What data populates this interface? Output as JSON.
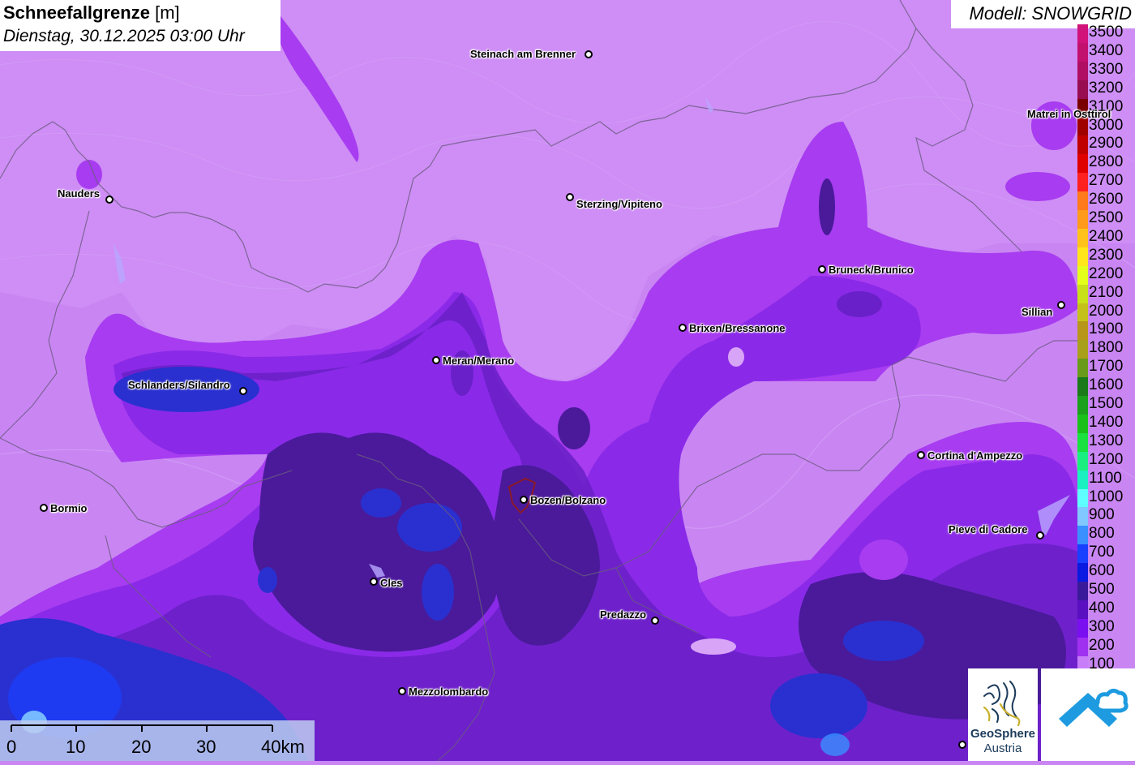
{
  "title": {
    "variable": "Schneefallgrenze",
    "unit": "[m]",
    "datetime": "Dienstag, 30.12.2025 03:00 Uhr"
  },
  "model": "Modell: SNOWGRID",
  "legend": {
    "items": [
      {
        "value": "3500",
        "color": "#d0127a"
      },
      {
        "value": "3400",
        "color": "#c2106f"
      },
      {
        "value": "3300",
        "color": "#b00e62"
      },
      {
        "value": "3200",
        "color": "#980c52"
      },
      {
        "value": "3100",
        "color": "#7a0000"
      },
      {
        "value": "3000",
        "color": "#a00000"
      },
      {
        "value": "2900",
        "color": "#c00000"
      },
      {
        "value": "2800",
        "color": "#e00000"
      },
      {
        "value": "2700",
        "color": "#ff2020"
      },
      {
        "value": "2600",
        "color": "#ff7a1a"
      },
      {
        "value": "2500",
        "color": "#ff9a1a"
      },
      {
        "value": "2400",
        "color": "#ffc21a"
      },
      {
        "value": "2300",
        "color": "#ffe61a"
      },
      {
        "value": "2200",
        "color": "#e4ff1a"
      },
      {
        "value": "2100",
        "color": "#c8e01a"
      },
      {
        "value": "2000",
        "color": "#c4c21a"
      },
      {
        "value": "1900",
        "color": "#b8961a"
      },
      {
        "value": "1800",
        "color": "#a8a01a"
      },
      {
        "value": "1700",
        "color": "#6a9a1a"
      },
      {
        "value": "1600",
        "color": "#1a7a1a"
      },
      {
        "value": "1500",
        "color": "#1aa01a"
      },
      {
        "value": "1400",
        "color": "#1ac01a"
      },
      {
        "value": "1300",
        "color": "#1ae040"
      },
      {
        "value": "1200",
        "color": "#1aee80"
      },
      {
        "value": "1100",
        "color": "#1af0c0"
      },
      {
        "value": "1000",
        "color": "#60ffff"
      },
      {
        "value": "900",
        "color": "#80c8ff"
      },
      {
        "value": "800",
        "color": "#3a90ff"
      },
      {
        "value": "700",
        "color": "#1a40ff"
      },
      {
        "value": "600",
        "color": "#0a1ae0"
      },
      {
        "value": "500",
        "color": "#3a1a9a"
      },
      {
        "value": "400",
        "color": "#5a10c0"
      },
      {
        "value": "300",
        "color": "#7a10f0"
      },
      {
        "value": "200",
        "color": "#a030f0"
      },
      {
        "value": "100",
        "color": "#c87ef8"
      }
    ]
  },
  "cities": [
    {
      "name": "Steinach am Brenner"
    },
    {
      "name": "Nauders"
    },
    {
      "name": "Sterzing/Vipiteno"
    },
    {
      "name": "Matrei in Osttirol"
    },
    {
      "name": "Bruneck/Brunico"
    },
    {
      "name": "Sillian"
    },
    {
      "name": "Brixen/Bressanone"
    },
    {
      "name": "Meran/Merano"
    },
    {
      "name": "Schlanders/Silandro"
    },
    {
      "name": "Cortina d'Ampezzo"
    },
    {
      "name": "Bormio"
    },
    {
      "name": "Bozen/Bolzano"
    },
    {
      "name": "Pieve di Cadore"
    },
    {
      "name": "Cles"
    },
    {
      "name": "Predazzo"
    },
    {
      "name": "Mezzolombardo"
    }
  ],
  "scale_bar": {
    "labels": [
      "0",
      "10",
      "20",
      "30",
      "40km"
    ]
  },
  "logo": {
    "line1": "GeoSphere",
    "line2": "Austria"
  }
}
